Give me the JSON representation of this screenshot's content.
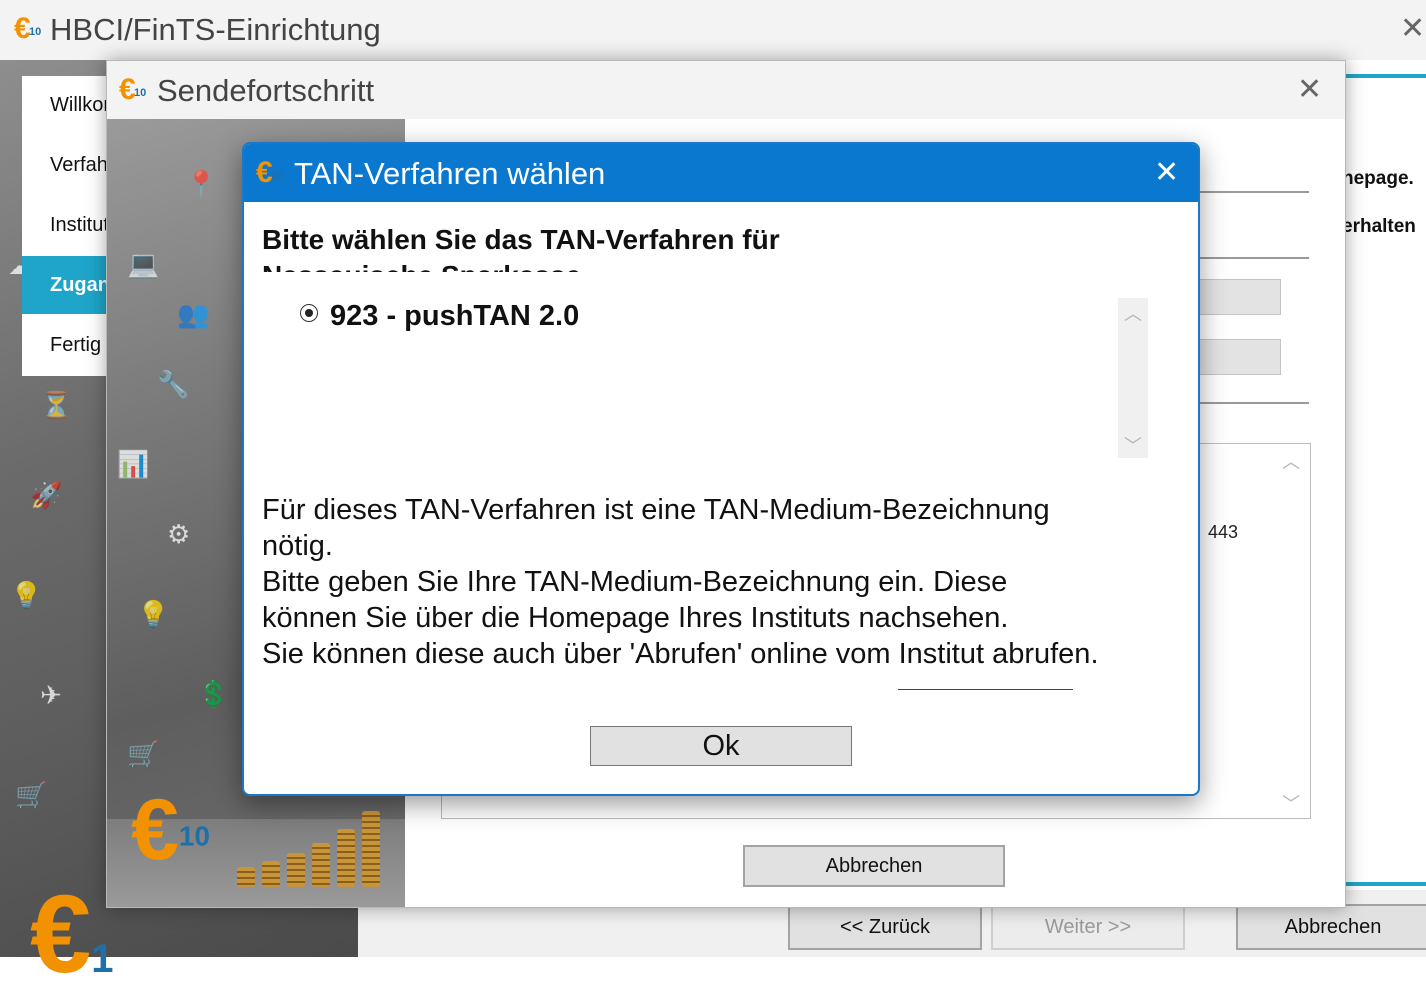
{
  "main_window": {
    "title": "HBCI/FinTS-Einrichtung",
    "close_glyph": "✕",
    "nav": [
      {
        "label": "Willkommen",
        "active": false
      },
      {
        "label": "Verfahren",
        "active": false
      },
      {
        "label": "Institut",
        "active": false
      },
      {
        "label": "Zugang",
        "active": true
      },
      {
        "label": "Fertig",
        "active": false
      }
    ],
    "right_text_1": "nepage.",
    "right_text_2": "erhalten",
    "buttons": {
      "back": "<< Zurück",
      "next": "Weiter >>",
      "cancel": "Abbrechen"
    }
  },
  "send_window": {
    "title": "Sendefortschritt",
    "close_glyph": "✕",
    "log_snippet": "443",
    "cancel": "Abbrechen"
  },
  "tan_dialog": {
    "title": "TAN-Verfahren wählen",
    "close_glyph": "✕",
    "heading_line1": "Bitte wählen Sie das TAN-Verfahren für",
    "heading_line2": "Nassauische Sparkasse",
    "options": [
      {
        "label": "923 - pushTAN 2.0",
        "selected": true
      }
    ],
    "info_lines": [
      "Für dieses TAN-Verfahren ist eine TAN-Medium-Bezeichnung",
      "nötig.",
      "Bitte geben Sie Ihre TAN-Medium-Bezeichnung ein. Diese",
      "können Sie über die Homepage Ihres Instituts nachsehen.",
      "Sie können diese auch über 'Abrufen' online vom Institut abrufen."
    ],
    "ok_label": "Ok"
  },
  "colors": {
    "accent_blue": "#0b78d0",
    "teal": "#1ea5c9",
    "brand_orange": "#f39200"
  },
  "icons": {
    "app_logo": "euro-10-logo",
    "close": "close-icon",
    "scroll_up": "chevron-up-icon",
    "scroll_down": "chevron-down-icon"
  }
}
